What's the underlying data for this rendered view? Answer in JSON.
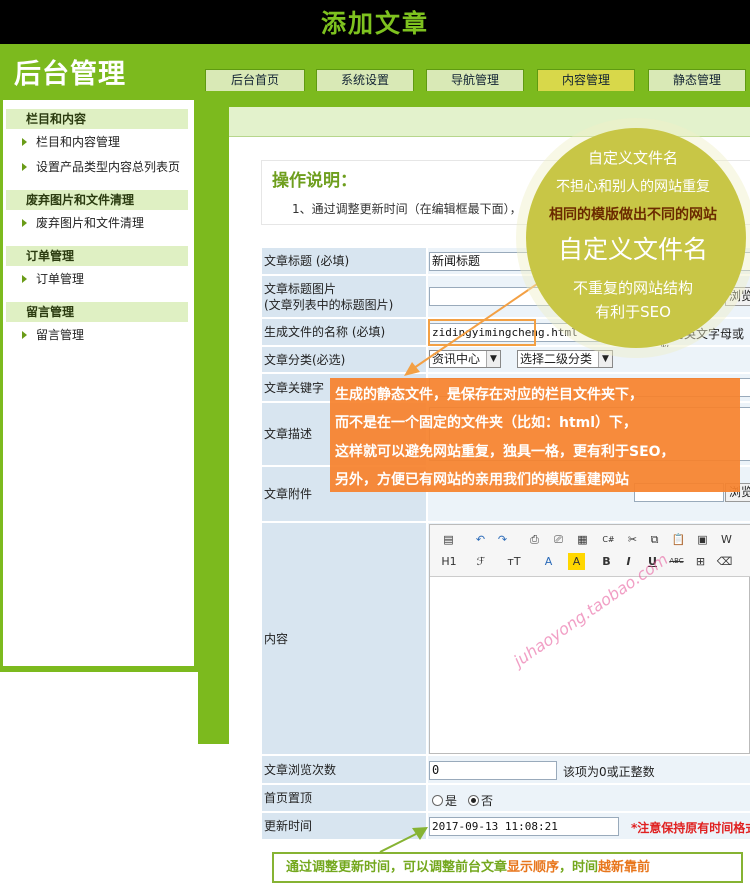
{
  "window_title": "添加文章",
  "logo_text": "后台管理",
  "tabs": [
    {
      "label": "后台首页",
      "active": false
    },
    {
      "label": "系统设置",
      "active": false
    },
    {
      "label": "导航管理",
      "active": false
    },
    {
      "label": "内容管理",
      "active": true
    },
    {
      "label": "静态管理",
      "active": false
    }
  ],
  "sidebar": {
    "groups": [
      {
        "title": "栏目和内容",
        "items": [
          "栏目和内容管理",
          "设置产品类型内容总列表页"
        ]
      },
      {
        "title": "废弃图片和文件清理",
        "items": [
          "废弃图片和文件清理"
        ]
      },
      {
        "title": "订单管理",
        "items": [
          "订单管理"
        ]
      },
      {
        "title": "留言管理",
        "items": [
          "留言管理"
        ]
      }
    ]
  },
  "instructions": {
    "title": "操作说明：",
    "text": "1、通过调整更新时间（在编辑框最下面），"
  },
  "form": {
    "title_label": "文章标题 (必填)",
    "title_value": "新闻标题",
    "image_label_1": "文章标题图片",
    "image_label_2": "(文章列表中的标题图片)",
    "browse_label": "浏览",
    "filename_label": "生成文件的名称 (必填)",
    "filename_value": "zidingyimingcheng.html",
    "filename_hint": "请用英文字母或数",
    "category_label": "文章分类(必选)",
    "category_value": "资讯中心",
    "subcategory_value": "选择二级分类",
    "keyword_label": "文章关键字",
    "desc_label": "文章描述",
    "attach_label": "文章附件",
    "content_label": "内容",
    "views_label": "文章浏览次数",
    "views_value": "0",
    "views_hint": "该项为0或正整数",
    "top_label": "首页置顶",
    "top_yes": "是",
    "top_no": "否",
    "top_selected": "否",
    "update_label": "更新时间",
    "update_value": "2017-09-13 11:08:21",
    "update_hint": "*注意保持原有时间格式"
  },
  "toolbar_icons": [
    "source-icon",
    "undo-icon",
    "redo-icon",
    "preview-icon",
    "print-icon",
    "template-icon",
    "code-icon",
    "cut-icon",
    "copy-icon",
    "paste-icon",
    "paste-text-icon",
    "paste-word-icon",
    "heading-icon",
    "font-icon",
    "font-size-icon",
    "font-color-icon",
    "highlight-icon",
    "bold-icon",
    "italic-icon",
    "underline-icon",
    "strike-icon",
    "table-icon",
    "eraser-icon"
  ],
  "toolbar_row2_labels": [
    "H1",
    "ℱ",
    "тT",
    "A",
    "A",
    "B",
    "I",
    "U",
    "ABC",
    "⊞",
    "⌫"
  ],
  "annotation_bubble": {
    "line1": "自定义文件名",
    "line2": "不担心和别人的网站重复",
    "line3": "相同的模版做出不同的网站",
    "line4": "自定义文件名",
    "line5": "不重复的网站结构",
    "line6": "有利于SEO"
  },
  "annotation_box": {
    "line1": "生成的静态文件，是保存在对应的栏目文件夹下，",
    "line2": "而不是在一个固定的文件夹（比如：html）下，",
    "line3": "这样就可以避免网站重复，独具一格，更有利于SEO，",
    "line4": "另外，方便已有网站的亲用我们的模版重建网站"
  },
  "bottom_note": {
    "part1": "通过调整更新时间，可以调整前台文章",
    "part2": "显示顺序",
    "part3": "，时间",
    "part4": "越新靠前"
  },
  "watermark": "juhaoyong.taobao.com",
  "colors": {
    "brand_green": "#7cba1e",
    "title_green": "#7ec21f",
    "bubble": "#c8c646",
    "orange": "#f6822d",
    "label_bg": "#d8e5f0"
  }
}
